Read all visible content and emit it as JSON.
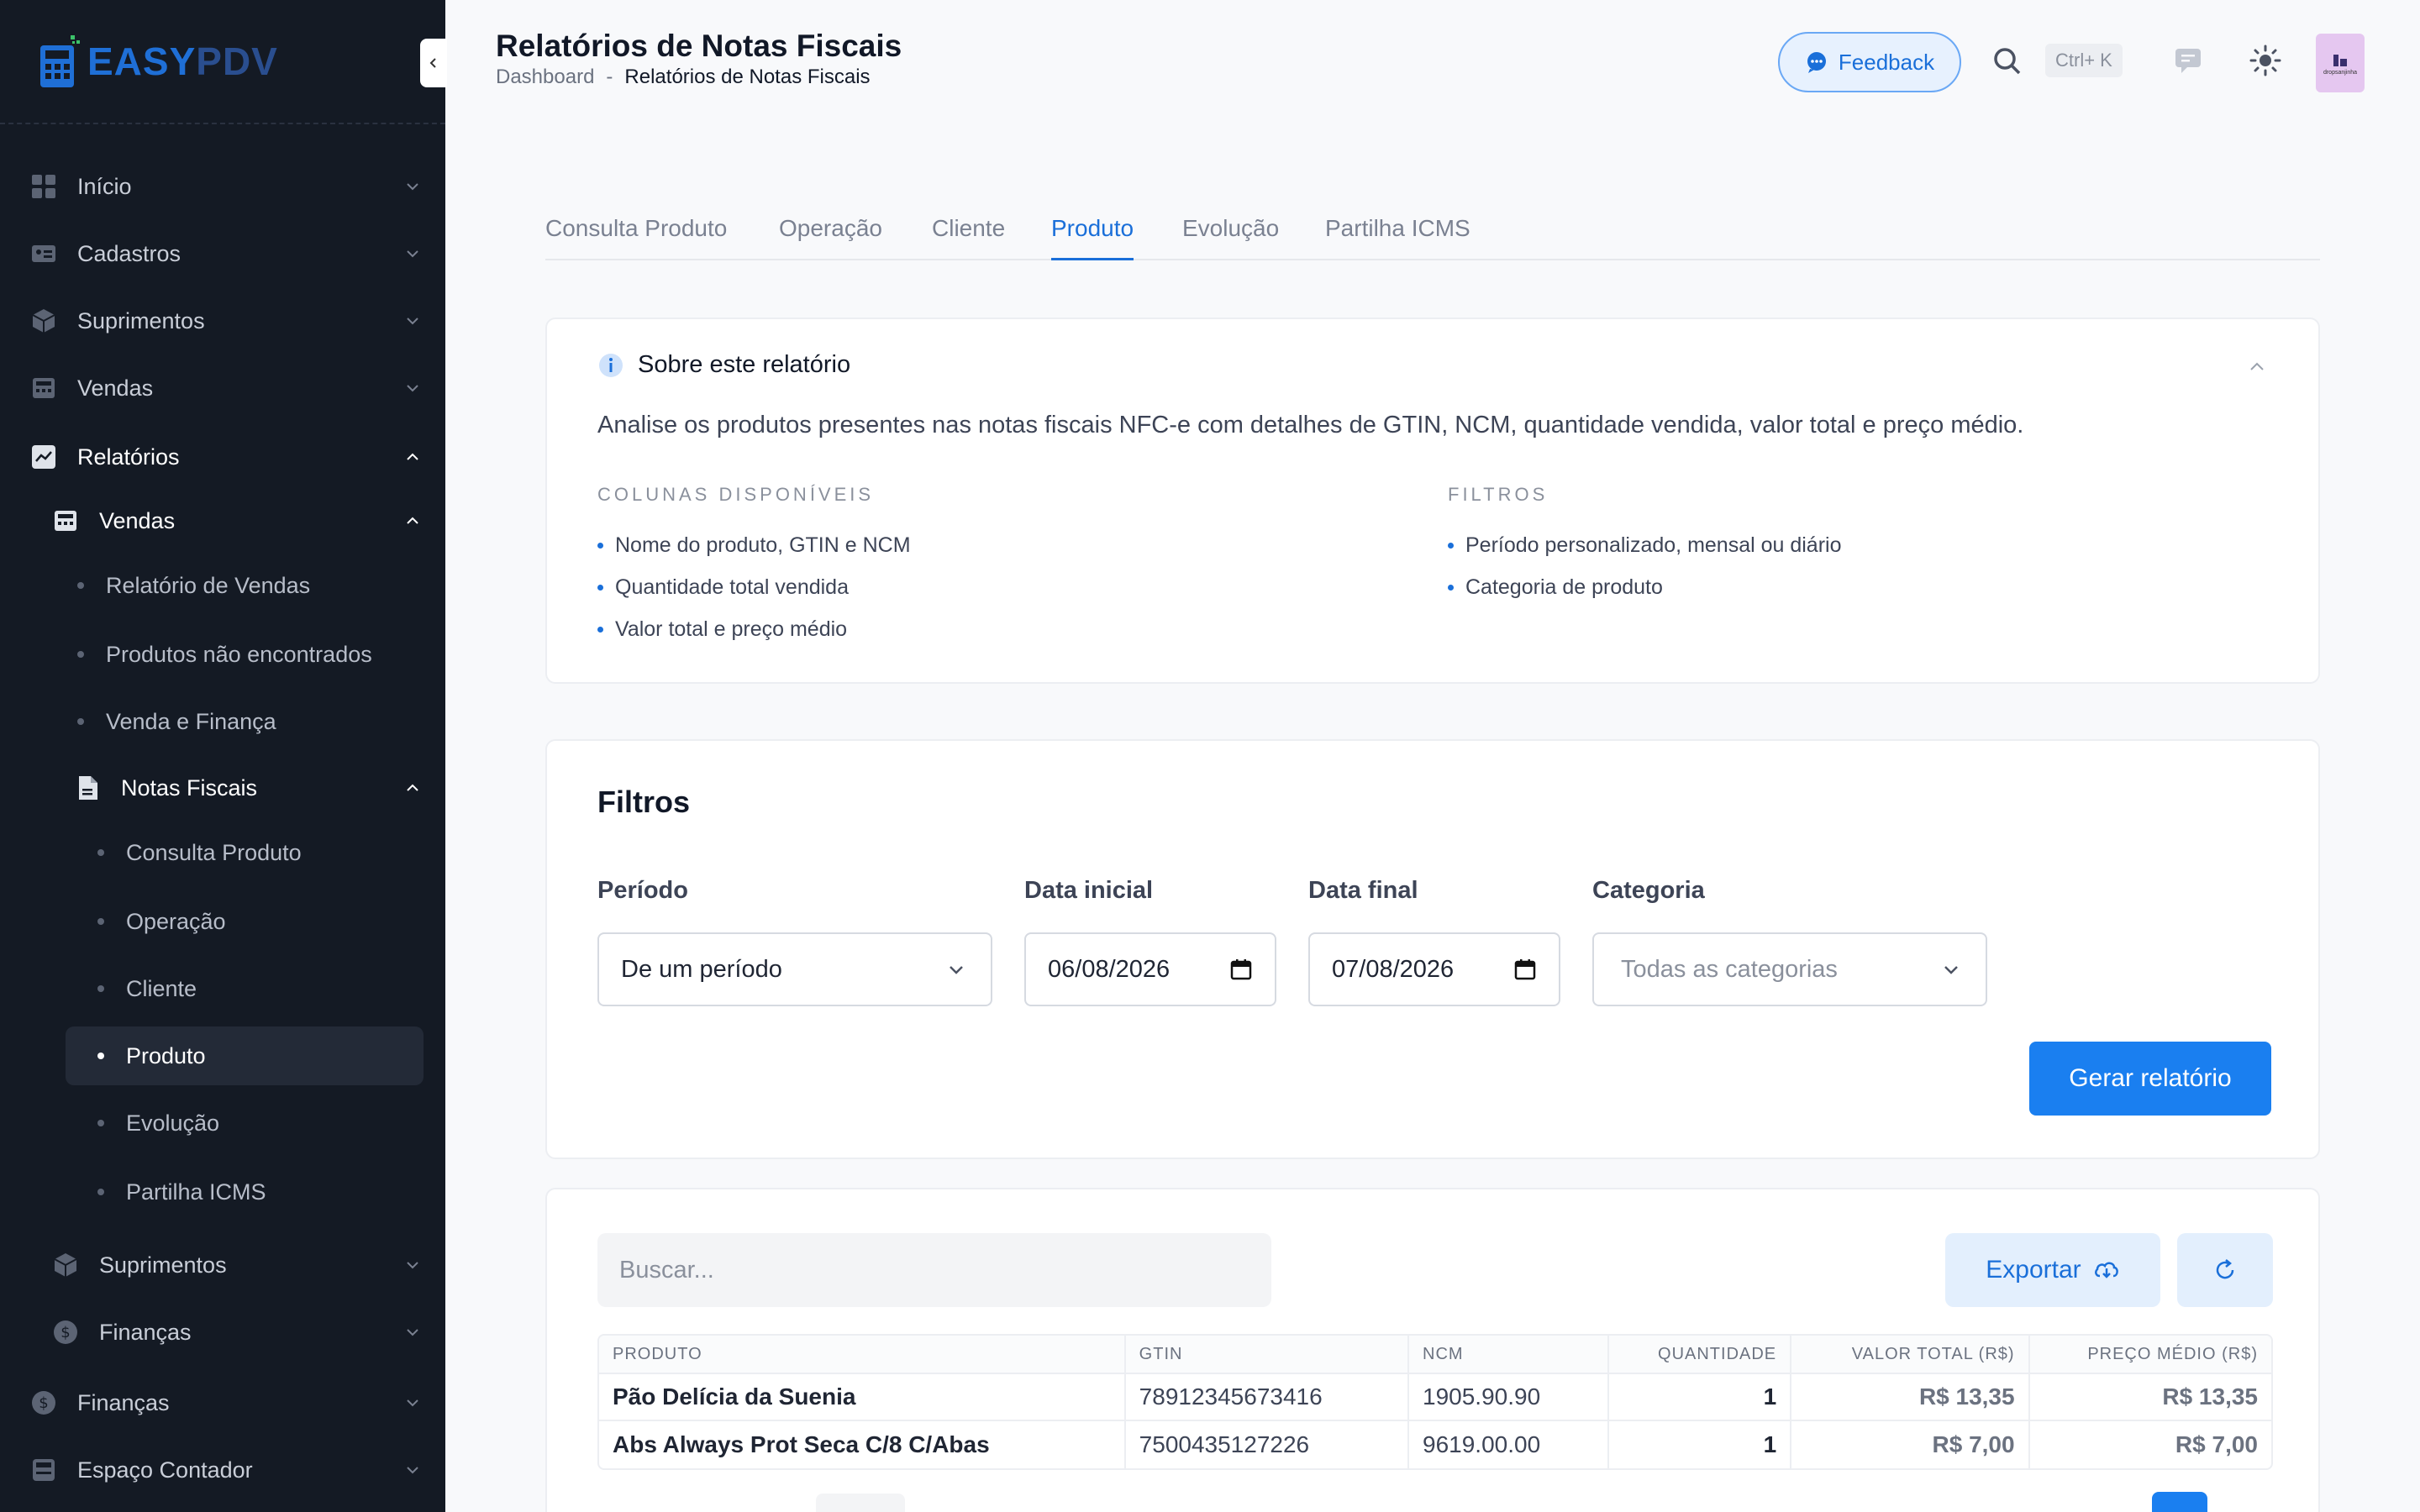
{
  "sidebar": {
    "logo": {
      "part1": "EASY",
      "part2": "PDV"
    },
    "items": [
      {
        "label": "Início"
      },
      {
        "label": "Cadastros"
      },
      {
        "label": "Suprimentos"
      },
      {
        "label": "Vendas"
      },
      {
        "label": "Relatórios"
      }
    ],
    "relatorios_sub": {
      "vendas": "Vendas",
      "vendas_items": [
        "Relatório de Vendas",
        "Produtos não encontrados",
        "Venda e Finança"
      ],
      "notas": "Notas Fiscais",
      "notas_items": [
        "Consulta Produto",
        "Operação",
        "Cliente",
        "Produto",
        "Evolução",
        "Partilha ICMS"
      ],
      "suprimentos": "Suprimentos",
      "financas": "Finanças"
    },
    "bottom_items": [
      {
        "label": "Finanças"
      },
      {
        "label": "Espaço Contador"
      }
    ]
  },
  "header": {
    "title": "Relatórios de Notas Fiscais",
    "breadcrumb_first": "Dashboard",
    "breadcrumb_sep": "-",
    "breadcrumb_last": "Relatórios de Notas Fiscais",
    "feedback_label": "Feedback",
    "shortcut": "Ctrl+ K",
    "avatar_text": "dropsanjinha"
  },
  "tabs": [
    "Consulta Produto",
    "Operação",
    "Cliente",
    "Produto",
    "Evolução",
    "Partilha ICMS"
  ],
  "active_tab": "Produto",
  "about": {
    "title": "Sobre este relatório",
    "description": "Analise os produtos presentes nas notas fiscais NFC-e com detalhes de GTIN, NCM, quantidade vendida, valor total e preço médio.",
    "columns_heading": "COLUNAS DISPONÍVEIS",
    "columns": [
      "Nome do produto, GTIN e NCM",
      "Quantidade total vendida",
      "Valor total e preço médio"
    ],
    "filters_heading": "FILTROS",
    "filters": [
      "Período personalizado, mensal ou diário",
      "Categoria de produto"
    ]
  },
  "filters": {
    "title": "Filtros",
    "periodo_label": "Período",
    "periodo_value": "De um período",
    "data_inicial_label": "Data inicial",
    "data_inicial_value": "06/08/2026",
    "data_final_label": "Data final",
    "data_final_value": "07/08/2026",
    "categoria_label": "Categoria",
    "categoria_placeholder": "Todas as categorias",
    "generate_label": "Gerar relatório"
  },
  "results": {
    "search_placeholder": "Buscar...",
    "export_label": "Exportar",
    "columns": [
      "PRODUTO",
      "GTIN",
      "NCM",
      "QUANTIDADE",
      "VALOR TOTAL (R$)",
      "PREÇO MÉDIO (R$)"
    ],
    "rows": [
      {
        "produto": "Pão Delícia da Suenia",
        "gtin": "78912345673416",
        "ncm": "1905.90.90",
        "quantidade": "1",
        "valor_total": "R$ 13,35",
        "preco_medio": "R$ 13,35"
      },
      {
        "produto": "Abs Always Prot Seca C/8 C/Abas",
        "gtin": "7500435127226",
        "ncm": "9619.00.00",
        "quantidade": "1",
        "valor_total": "R$ 7,00",
        "preco_medio": "R$ 7,00"
      }
    ]
  },
  "colors": {
    "sidebar_bg": "#141a24",
    "accent": "#1a7ff0",
    "page_bg": "#f8f9fb"
  }
}
